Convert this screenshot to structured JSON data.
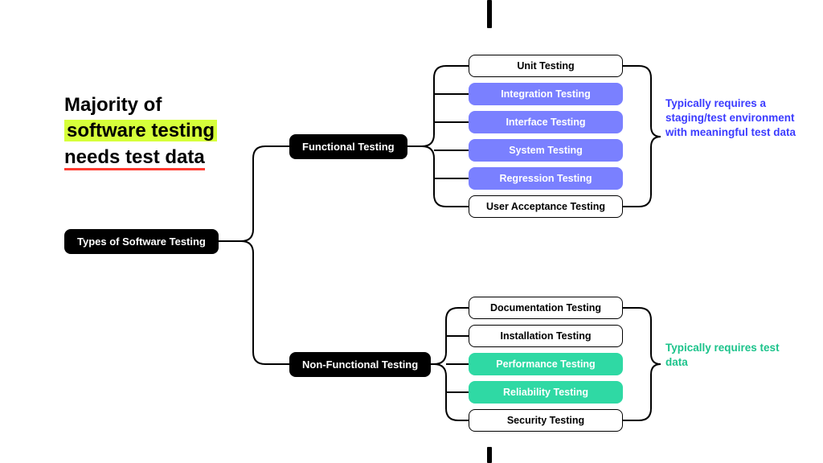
{
  "title": {
    "line1": "Majority of",
    "line2_hl": "software testing",
    "line3_ul": "needs test data"
  },
  "root": "Types of Software Testing",
  "branches": {
    "functional": {
      "label": "Functional Testing",
      "leaves": [
        {
          "label": "Unit Testing",
          "highlight": "none"
        },
        {
          "label": "Integration Testing",
          "highlight": "blue"
        },
        {
          "label": "Interface Testing",
          "highlight": "blue"
        },
        {
          "label": "System Testing",
          "highlight": "blue"
        },
        {
          "label": "Regression Testing",
          "highlight": "blue"
        },
        {
          "label": "User Acceptance Testing",
          "highlight": "none"
        }
      ]
    },
    "nonfunctional": {
      "label": "Non-Functional Testing",
      "leaves": [
        {
          "label": "Documentation Testing",
          "highlight": "none"
        },
        {
          "label": "Installation Testing",
          "highlight": "none"
        },
        {
          "label": "Performance Testing",
          "highlight": "green"
        },
        {
          "label": "Reliability Testing",
          "highlight": "green"
        },
        {
          "label": "Security Testing",
          "highlight": "none"
        }
      ]
    }
  },
  "notes": {
    "blue": "Typically requires a staging/test environment with meaningful test data",
    "green": "Typically requires test data"
  },
  "colors": {
    "highlight_yellow": "#d6ff3a",
    "underline_red": "#ff3b30",
    "leaf_blue": "#7a80ff",
    "leaf_green": "#2fd9a4",
    "note_blue": "#3b3bff",
    "note_green": "#1cc38b"
  }
}
